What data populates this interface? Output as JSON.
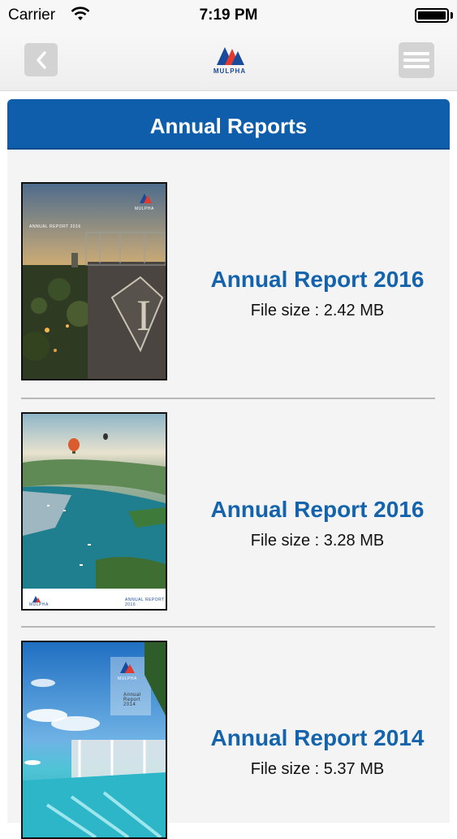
{
  "status_bar": {
    "carrier": "Carrier",
    "time": "7:19 PM"
  },
  "nav": {
    "logo_text": "MULPHA",
    "back_icon": "chevron-left-icon",
    "menu_icon": "hamburger-menu-icon"
  },
  "header": {
    "title": "Annual Reports"
  },
  "reports": [
    {
      "title": "Annual Report 2016",
      "file_size": "File size : 2.42 MB",
      "cover_text": "ANNUAL REPORT 2016",
      "cover_logo": "MULPHA"
    },
    {
      "title": "Annual Report 2016",
      "file_size": "File size : 3.28 MB",
      "cover_text": "ANNUAL REPORT 2016",
      "cover_logo": "MULPHA"
    },
    {
      "title": "Annual Report 2014",
      "file_size": "File size : 5.37 MB",
      "cover_text": "Annual Report 2014",
      "cover_logo": "MULPHA"
    }
  ],
  "colors": {
    "header_blue": "#0e5eab",
    "title_blue": "#1463ad",
    "logo_red": "#e23a2e",
    "logo_blue": "#1a4a9c"
  }
}
